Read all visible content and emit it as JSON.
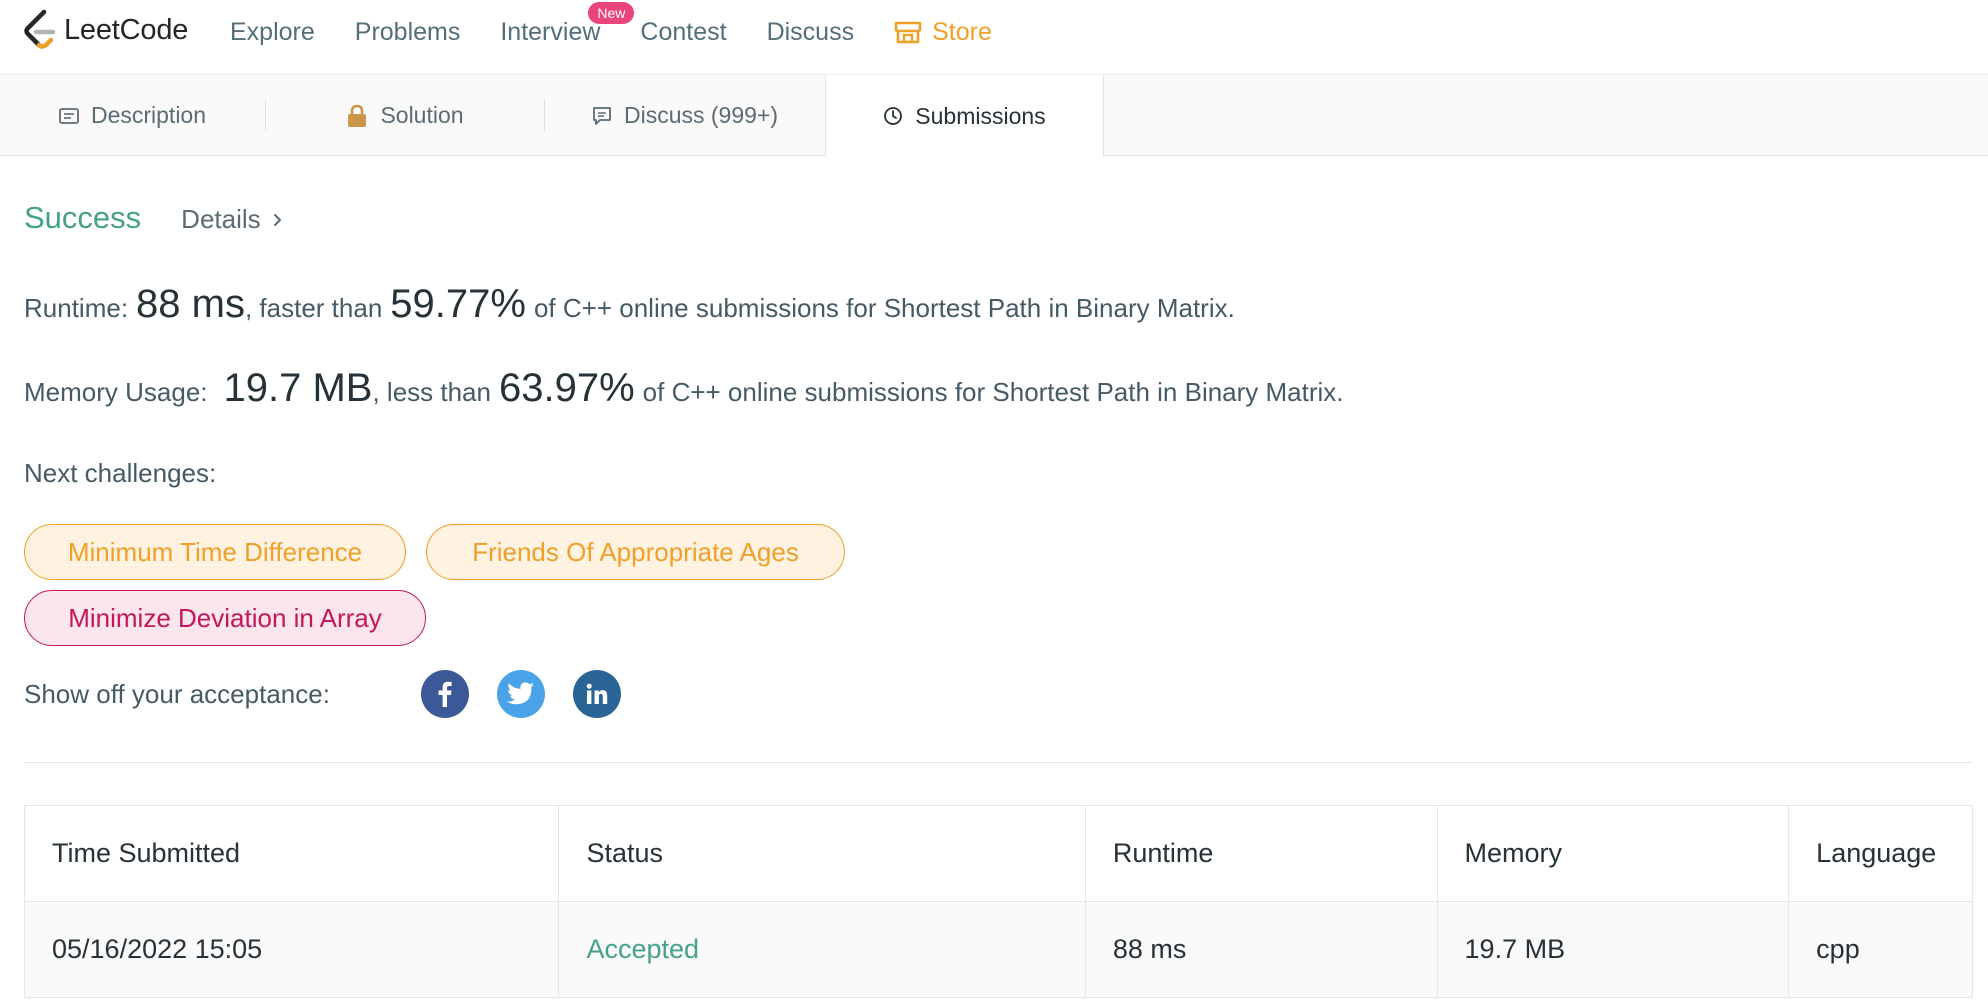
{
  "navbar": {
    "logo_text": "LeetCode",
    "links": [
      "Explore",
      "Problems",
      "Interview",
      "Contest",
      "Discuss"
    ],
    "interview_badge": "New",
    "store_label": "Store",
    "store_color": "#f0a028"
  },
  "tabs": [
    {
      "label": "Description",
      "icon": "description-icon"
    },
    {
      "label": "Solution",
      "icon": "lock-icon"
    },
    {
      "label": "Discuss (999+)",
      "icon": "comment-icon"
    },
    {
      "label": "Submissions",
      "icon": "clock-icon",
      "active": true
    }
  ],
  "result": {
    "status": "Success",
    "details_label": "Details",
    "runtime": {
      "label": "Runtime:",
      "value": "88 ms",
      "mid": ", faster than",
      "percent": "59.77%",
      "suffix": "of C++ online submissions for Shortest Path in Binary Matrix."
    },
    "memory": {
      "label": "Memory Usage:",
      "value": "19.7 MB",
      "mid": ", less than",
      "percent": "63.97%",
      "suffix": "of C++ online submissions for Shortest Path in Binary Matrix."
    },
    "next_label": "Next challenges:",
    "challenges": [
      {
        "label": "Minimum Time Difference",
        "difficulty": "medium"
      },
      {
        "label": "Friends Of Appropriate Ages",
        "difficulty": "medium"
      },
      {
        "label": "Minimize Deviation in Array",
        "difficulty": "hard"
      }
    ],
    "share_label": "Show off your acceptance:",
    "social": [
      {
        "icon": "facebook-icon",
        "color": "#3b5998"
      },
      {
        "icon": "twitter-icon",
        "color": "#4aa3e8"
      },
      {
        "icon": "linkedin-icon",
        "color": "#2a6496"
      }
    ]
  },
  "table": {
    "headers": [
      "Time Submitted",
      "Status",
      "Runtime",
      "Memory",
      "Language"
    ],
    "rows": [
      [
        "05/16/2022 15:05",
        "Accepted",
        "88 ms",
        "19.7 MB",
        "cpp"
      ]
    ],
    "accepted_color": "#45a18a"
  }
}
